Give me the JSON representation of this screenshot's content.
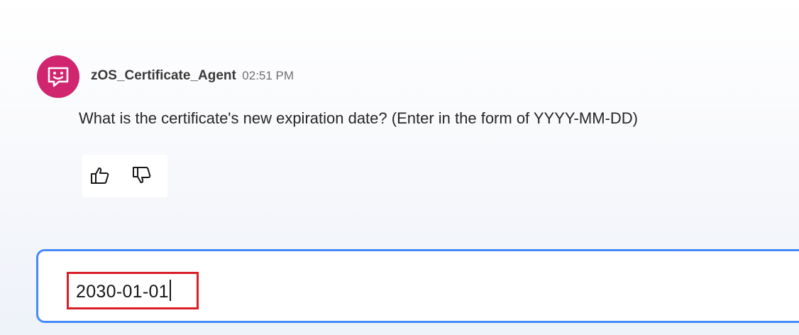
{
  "message": {
    "avatar_icon": "chat-bot-icon",
    "sender": "zOS_Certificate_Agent",
    "timestamp": "02:51 PM",
    "text": "What is the certificate's new expiration date? (Enter in the form of YYYY-MM-DD)",
    "feedback": {
      "thumbs_up_icon": "thumbs-up-icon",
      "thumbs_down_icon": "thumbs-down-icon"
    }
  },
  "input": {
    "value": "2030-01-01"
  },
  "colors": {
    "avatar": "#d02670",
    "input_border": "#4589ff",
    "highlight_box": "#da1e28"
  }
}
